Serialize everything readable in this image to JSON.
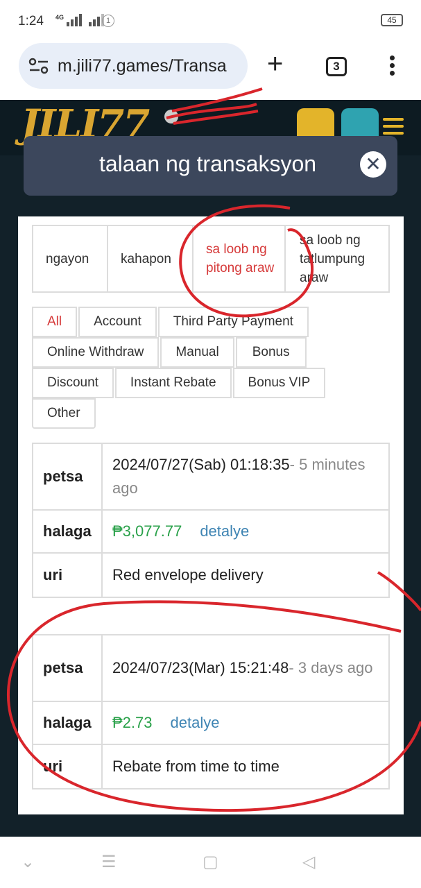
{
  "status_bar": {
    "time": "1:24",
    "network": "4G",
    "notif_count": "1",
    "battery": "45"
  },
  "browser": {
    "url": "m.jili77.games/Transa",
    "tab_count": "3"
  },
  "site": {
    "logo": "JILI77"
  },
  "modal": {
    "title": "talaan ng transaksyon",
    "close_symbol": "✕"
  },
  "day_tabs": [
    {
      "label": "ngayon",
      "active": false
    },
    {
      "label": "kahapon",
      "active": false
    },
    {
      "label": "sa loob ng pitong araw",
      "active": true
    },
    {
      "label": "sa loob ng tatlumpung araw",
      "active": false
    }
  ],
  "filters": [
    {
      "label": "All",
      "active": true
    },
    {
      "label": "Account"
    },
    {
      "label": "Third Party Payment"
    },
    {
      "label": "Online Withdraw"
    },
    {
      "label": "Manual"
    },
    {
      "label": "Bonus"
    },
    {
      "label": "Discount"
    },
    {
      "label": "Instant Rebate"
    },
    {
      "label": "Bonus VIP"
    },
    {
      "label": "Other"
    }
  ],
  "records": [
    {
      "date_label": "petsa",
      "date": "2024/07/27(Sab) 01:18:35",
      "ago": "- 5 minutes ago",
      "amount_label": "halaga",
      "amount": "₱3,077.77",
      "detail_link": "detalye",
      "type_label": "uri",
      "type": "Red envelope delivery"
    },
    {
      "date_label": "petsa",
      "date": "2024/07/23(Mar) 15:21:48",
      "ago": "- 3 days ago",
      "amount_label": "halaga",
      "amount": "₱2.73",
      "detail_link": "detalye",
      "type_label": "uri",
      "type": "Rebate from time to time"
    }
  ],
  "colors": {
    "active_red": "#d63a3a",
    "amount_green": "#2aa14a",
    "link_blue": "#3e84b3",
    "annotation_red": "#d9262c"
  }
}
